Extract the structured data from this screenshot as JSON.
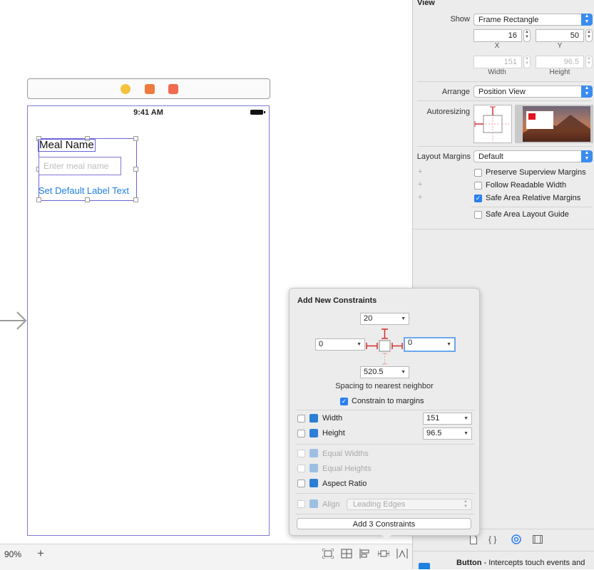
{
  "canvas": {
    "status_time": "9:41 AM",
    "meal_label": "Meal Name",
    "meal_placeholder": "Enter meal name",
    "default_button": "Set Default Label Text",
    "zoom": "90%",
    "zoom_plus": "+"
  },
  "inspector": {
    "section_title": "View",
    "show_label": "Show",
    "show_value": "Frame Rectangle",
    "x_value": "16",
    "y_value": "50",
    "x_label": "X",
    "y_label": "Y",
    "width_value": "151",
    "height_value": "96.5",
    "width_label": "Width",
    "height_label": "Height",
    "arrange_label": "Arrange",
    "arrange_value": "Position View",
    "autoresizing_label": "Autoresizing",
    "layout_margins_label": "Layout Margins",
    "layout_margins_value": "Default",
    "options": [
      {
        "label": "Preserve Superview Margins",
        "checked": false
      },
      {
        "label": "Follow Readable Width",
        "checked": false
      },
      {
        "label": "Safe Area Relative Margins",
        "checked": true
      },
      {
        "label": "Safe Area Layout Guide",
        "checked": false
      }
    ],
    "library_title": "Button",
    "library_desc": "- Intercepts touch events and"
  },
  "popover": {
    "title": "Add New Constraints",
    "top_value": "20",
    "left_value": "0",
    "right_value": "0",
    "bottom_value": "520.5",
    "spacing_caption": "Spacing to nearest neighbor",
    "constrain_margins": "Constrain to margins",
    "width_label": "Width",
    "width_value": "151",
    "height_label": "Height",
    "height_value": "96.5",
    "equal_widths": "Equal Widths",
    "equal_heights": "Equal Heights",
    "aspect_ratio": "Aspect Ratio",
    "align_label": "Align",
    "align_value": "Leading Edges",
    "add_button": "Add 3 Constraints"
  },
  "colors": {
    "accent": "#2b7ff0",
    "selection": "#6a64d8",
    "constraint_red": "#d0312d",
    "link_blue": "#1d7fe0"
  }
}
